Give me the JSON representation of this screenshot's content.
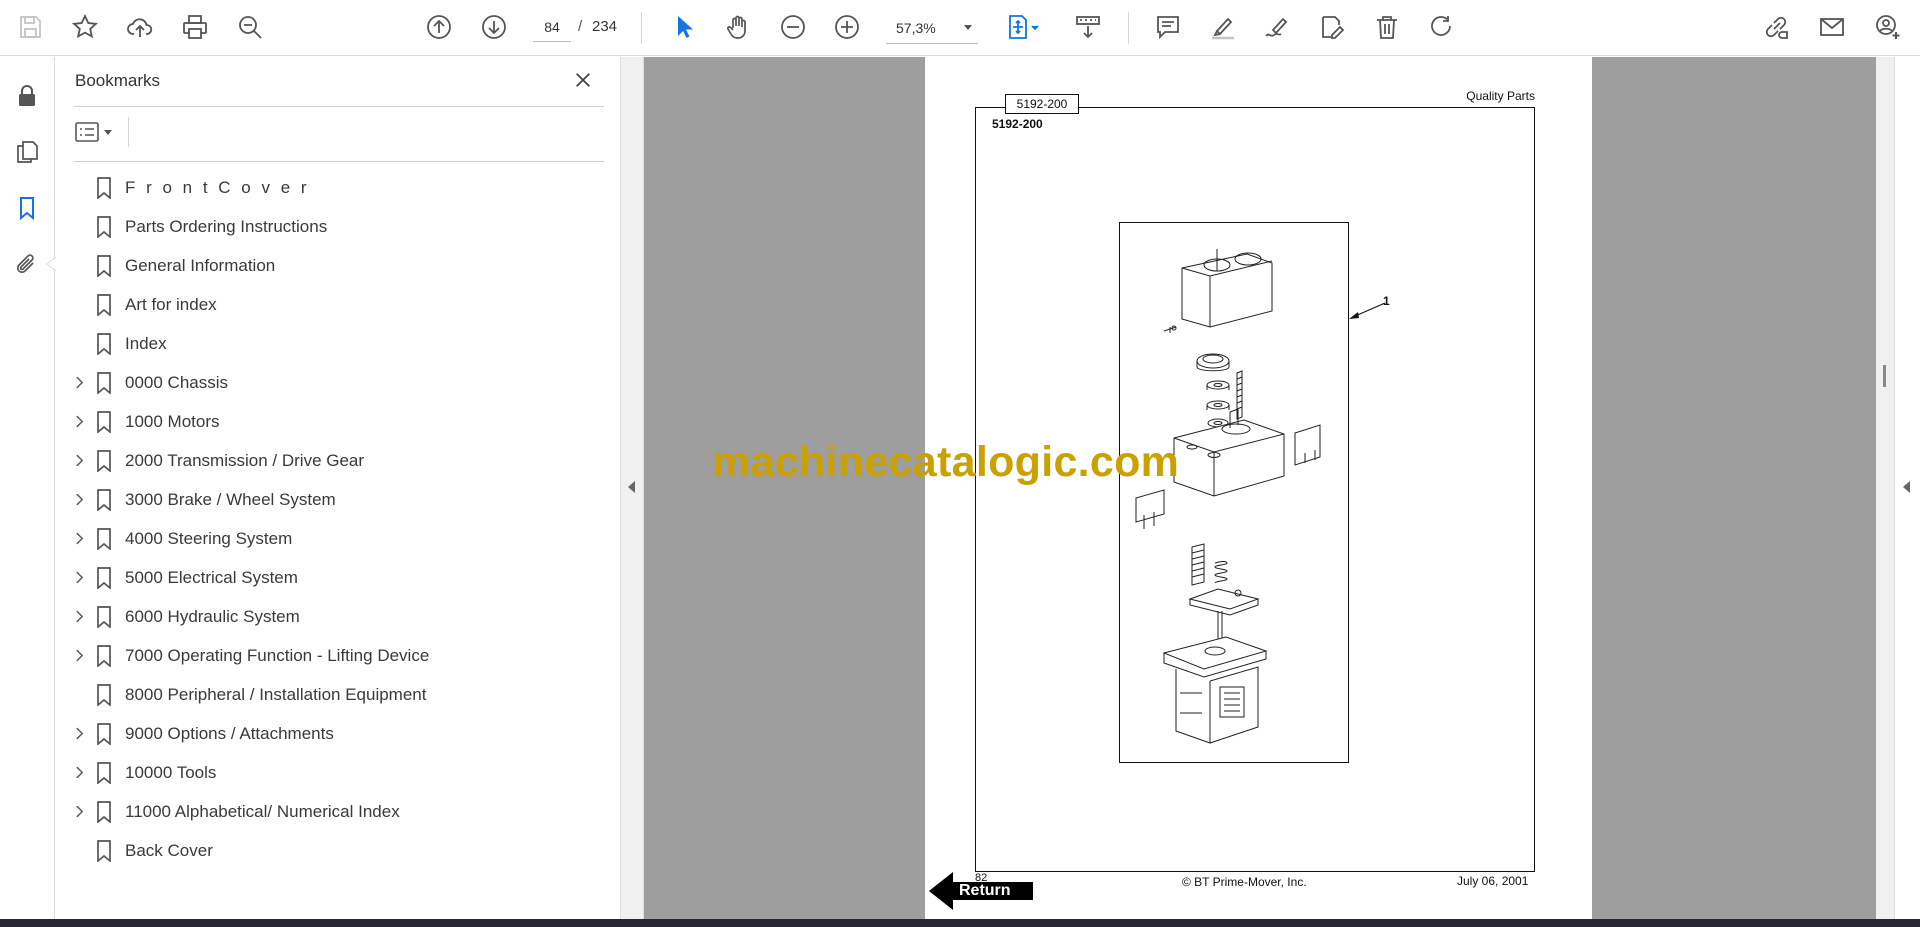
{
  "toolbar": {
    "page_current": "84",
    "page_separator": "/",
    "page_total": "234",
    "zoom": "57,3%"
  },
  "bookmarks": {
    "title": "Bookmarks",
    "items": [
      {
        "label": "F r o n t C o v e r",
        "expandable": false
      },
      {
        "label": "Parts Ordering Instructions",
        "expandable": false
      },
      {
        "label": "General Information",
        "expandable": false
      },
      {
        "label": "Art for index",
        "expandable": false
      },
      {
        "label": "Index",
        "expandable": false
      },
      {
        "label": "0000 Chassis",
        "expandable": true
      },
      {
        "label": "1000 Motors",
        "expandable": true
      },
      {
        "label": "2000 Transmission / Drive Gear",
        "expandable": true
      },
      {
        "label": "3000 Brake / Wheel System",
        "expandable": true
      },
      {
        "label": "4000 Steering System",
        "expandable": true
      },
      {
        "label": "5000 Electrical System",
        "expandable": true
      },
      {
        "label": "6000 Hydraulic System",
        "expandable": true
      },
      {
        "label": "7000 Operating Function - Lifting Device",
        "expandable": true
      },
      {
        "label": "8000 Peripheral / Installation Equipment",
        "expandable": false
      },
      {
        "label": "9000 Options / Attachments",
        "expandable": true
      },
      {
        "label": "10000 Tools",
        "expandable": true
      },
      {
        "label": "11000 Alphabetical/ Numerical Index",
        "expandable": true
      },
      {
        "label": "Back Cover",
        "expandable": false
      }
    ]
  },
  "document": {
    "section_tab": "5192-200",
    "section_heading": "5192-200",
    "header_right": "Quality Parts",
    "callout": "1",
    "page_number": "82",
    "copyright": "© BT Prime-Mover, Inc.",
    "date": "July 06, 2001",
    "return_label": "Return",
    "watermark": "machinecatalogic.com"
  },
  "colors": {
    "accent": "#1473e6",
    "viewer_background": "#9e9e9e",
    "watermark": "#c9a100"
  }
}
